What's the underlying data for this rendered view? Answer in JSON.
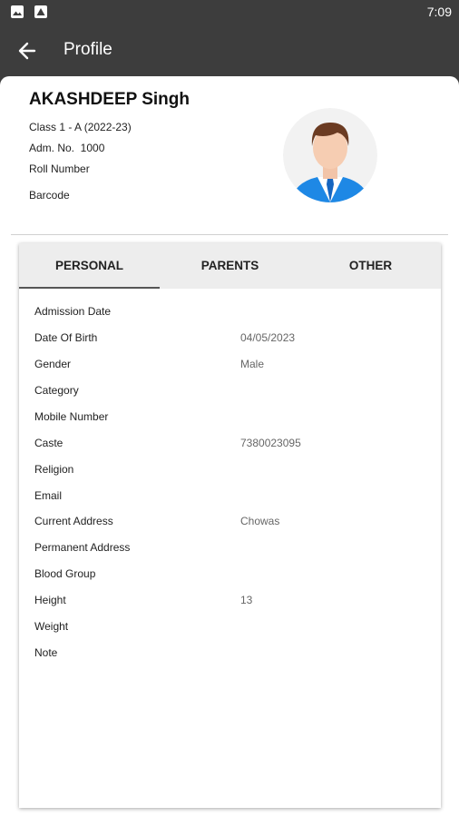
{
  "status_bar": {
    "time": "7:09",
    "icons": [
      "image-icon",
      "photo-icon"
    ]
  },
  "app_bar": {
    "title": "Profile",
    "back_icon": "arrow-left-icon"
  },
  "student": {
    "name": "AKASHDEEP Singh",
    "class_line": "Class 1 - A (2022-23)",
    "adm_line": "Adm. No.  1000",
    "roll_label": "Roll Number",
    "barcode_label": "Barcode"
  },
  "tabs": [
    {
      "label": "PERSONAL",
      "active": true
    },
    {
      "label": "PARENTS",
      "active": false
    },
    {
      "label": "OTHER",
      "active": false
    }
  ],
  "fields": [
    {
      "label": "Admission Date",
      "value": ""
    },
    {
      "label": "Date Of Birth",
      "value": "04/05/2023"
    },
    {
      "label": "Gender",
      "value": "Male"
    },
    {
      "label": "Category",
      "value": ""
    },
    {
      "label": "Mobile Number",
      "value": ""
    },
    {
      "label": "Caste",
      "value": "7380023095"
    },
    {
      "label": "Religion",
      "value": ""
    },
    {
      "label": "Email",
      "value": ""
    },
    {
      "label": "Current Address",
      "value": "Chowas"
    },
    {
      "label": "Permanent Address",
      "value": ""
    },
    {
      "label": "Blood Group",
      "value": ""
    },
    {
      "label": "Height",
      "value": "13"
    },
    {
      "label": "Weight",
      "value": ""
    },
    {
      "label": "Note",
      "value": ""
    }
  ],
  "colors": {
    "header_bg": "#3d3d3d",
    "tab_bg": "#ededed",
    "accent": "#1e88e5"
  }
}
